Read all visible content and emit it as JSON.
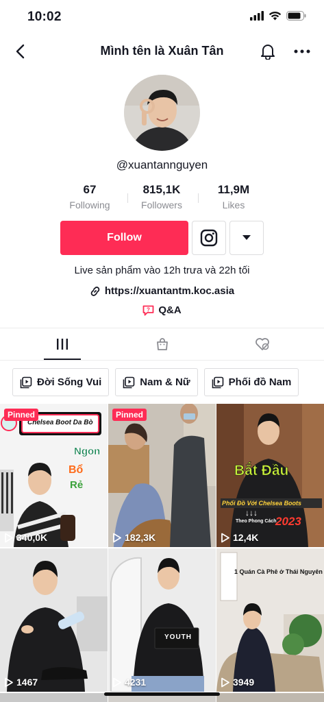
{
  "status": {
    "time": "10:02"
  },
  "nav": {
    "title": "Mình tên là Xuân Tân"
  },
  "profile": {
    "username": "@xuantannguyen",
    "stats": [
      {
        "value": "67",
        "label": "Following"
      },
      {
        "value": "815,1K",
        "label": "Followers"
      },
      {
        "value": "11,9M",
        "label": "Likes"
      }
    ],
    "follow_label": "Follow",
    "bio": "Live sản phẩm vào 12h trưa và 22h tối",
    "link": "https://xuantantm.koc.asia",
    "qa_label": "Q&A"
  },
  "tabs": [
    {
      "icon": "grid-icon",
      "active": true
    },
    {
      "icon": "shopping-bag-icon",
      "active": false
    },
    {
      "icon": "liked-heart-icon",
      "active": false
    }
  ],
  "playlists": [
    "Đời Sống Vui",
    "Nam & Nữ",
    "Phối đồ Nam"
  ],
  "videos": [
    {
      "pinned": "Pinned",
      "views": "340,0K",
      "overlay": [
        "Chelsea Boot Da Bò",
        "Ngon",
        "Bổ",
        "Rẻ"
      ]
    },
    {
      "pinned": "Pinned",
      "views": "182,3K",
      "overlay": []
    },
    {
      "pinned": "",
      "views": "12,4K",
      "overlay": [
        "Bắt Đầu",
        "Phối Đồ Với Chelsea Boots",
        "Theo Phong Cách",
        "2023"
      ]
    },
    {
      "pinned": "",
      "views": "1467",
      "overlay": []
    },
    {
      "pinned": "",
      "views": "4231",
      "overlay": [
        "YOUTH"
      ]
    },
    {
      "pinned": "",
      "views": "3949",
      "overlay": [
        "1 Quán Cà Phê ở Thái Nguyên"
      ]
    }
  ],
  "colors": {
    "accent": "#fe2c55",
    "text": "#161823",
    "muted": "#8a8b91"
  }
}
